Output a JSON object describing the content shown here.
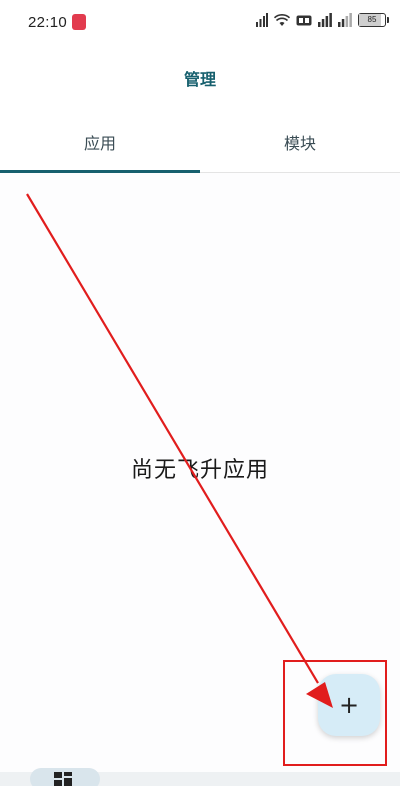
{
  "status_bar": {
    "time": "22:10",
    "battery_level": "85",
    "icons": [
      "notification-app-icon",
      "signal-icon",
      "wifi-icon",
      "hd-icon",
      "signal-icon",
      "signal-icon",
      "battery-icon"
    ]
  },
  "header": {
    "title": "管理"
  },
  "tabs": [
    {
      "label": "应用",
      "selected": true
    },
    {
      "label": "模块",
      "selected": false
    }
  ],
  "main": {
    "empty_message": "尚无飞升应用"
  },
  "fab": {
    "icon": "plus-icon",
    "label": "+"
  },
  "bottom_nav": {
    "items": [
      {
        "icon": "grid-icon",
        "selected": true
      }
    ]
  },
  "colors": {
    "accent": "#17606e",
    "fab_background": "#d6ecf7",
    "annotation": "#e11d1d"
  }
}
